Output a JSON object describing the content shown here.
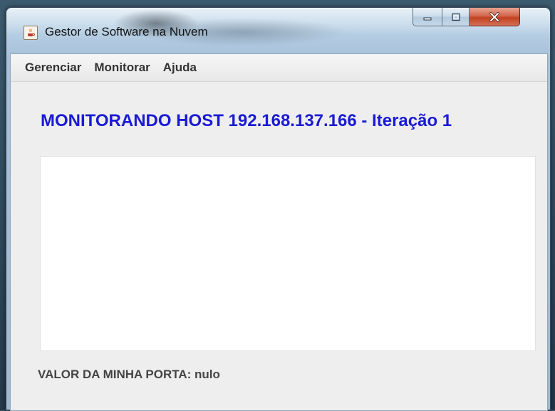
{
  "window": {
    "title": "Gestor de Software na Nuvem",
    "app_icon": "java-cup-icon"
  },
  "controls": {
    "minimize_icon": "minimize-icon",
    "maximize_icon": "maximize-icon",
    "close_icon": "close-icon"
  },
  "menubar": {
    "items": [
      "Gerenciar",
      "Monitorar",
      "Ajuda"
    ]
  },
  "main": {
    "heading": "MONITORANDO HOST 192.168.137.166 - Iteração 1",
    "port_label": "VALOR DA MINHA PORTA: nulo"
  },
  "colors": {
    "heading": "#1a1ad6",
    "close_button": "#c1421f"
  }
}
